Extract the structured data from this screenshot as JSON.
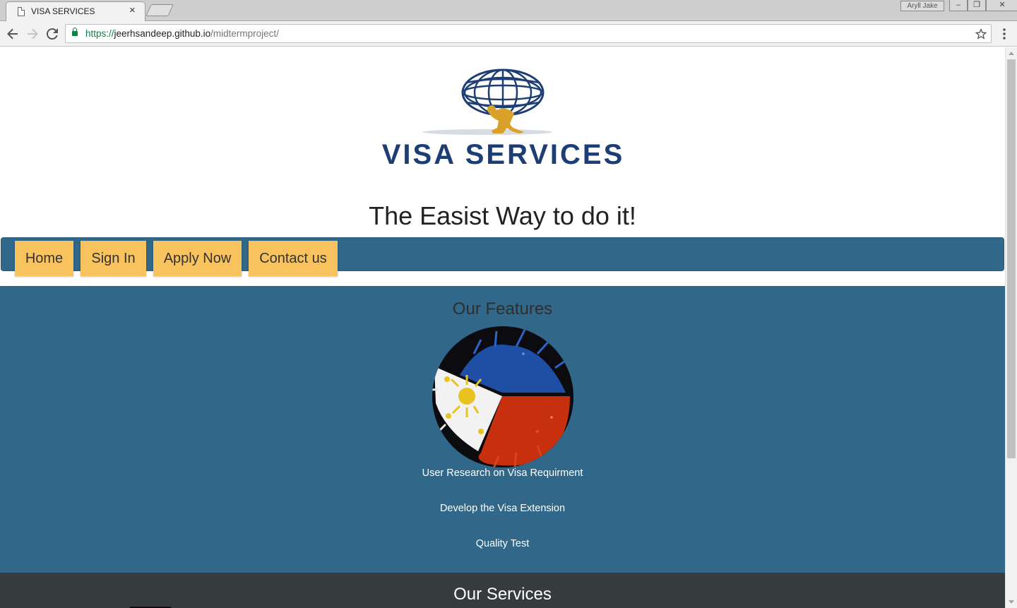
{
  "browser": {
    "tab_title": "VISA SERVICES",
    "tab_close": "×",
    "profile_name": "Aryll Jake",
    "url_scheme": "https://",
    "url_host": "jeerhsandeep.github.io",
    "url_path": "/midtermproject/",
    "win_minimize": "–",
    "win_restore": "❐",
    "win_close": "✕"
  },
  "page": {
    "logo_text": "VISA SERVICES",
    "tagline": "The Easist Way to do it!",
    "nav": [
      {
        "label": "Home"
      },
      {
        "label": "Sign In"
      },
      {
        "label": "Apply Now"
      },
      {
        "label": "Contact us"
      }
    ],
    "features": {
      "title": "Our Features",
      "items": [
        {
          "label": "User Research on Visa Requirment"
        },
        {
          "label": "Develop the Visa Extension"
        },
        {
          "label": "Quality Test"
        }
      ]
    },
    "services": {
      "title": "Our Services"
    }
  },
  "colors": {
    "nav_bar": "#316788",
    "nav_button": "#f8c35e",
    "features_bg": "#316788",
    "services_bg": "#363c3d",
    "logo_blue": "#1d3e75",
    "logo_gold": "#d9a12a"
  }
}
